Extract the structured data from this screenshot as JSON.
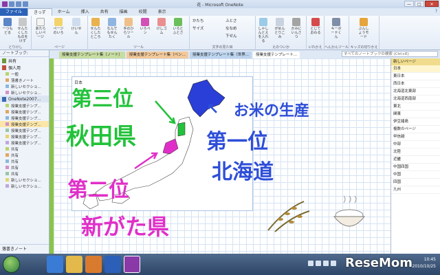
{
  "window": {
    "title": "花 - Microsoft OneNote",
    "buttons": {
      "minimize": "—",
      "maximize": "□",
      "close": "✕"
    }
  },
  "tabs": [
    {
      "label": "ファイル"
    },
    {
      "label": "きっず"
    },
    {
      "label": "ホーム"
    },
    {
      "label": "挿入"
    },
    {
      "label": "共有"
    },
    {
      "label": "描画"
    },
    {
      "label": "校閲"
    },
    {
      "label": "表示"
    }
  ],
  "ribbon": {
    "groups": [
      {
        "label": "とりけし"
      },
      {
        "label": "ページ"
      },
      {
        "label": "ツール"
      },
      {
        "label": "文字の見た目"
      },
      {
        "label": "えのついか"
      },
      {
        "label": "いれかえ"
      },
      {
        "label": "へんかんツール"
      },
      {
        "label": "キッズの切りかえ"
      }
    ],
    "buttons": [
      {
        "label": "一つもどる"
      },
      {
        "label": "せんたくしたものをけす"
      },
      {
        "label": "あたらしいページ"
      },
      {
        "label": "ページのいろ"
      },
      {
        "label": "けいせん"
      },
      {
        "label": "せんたくしたところ"
      },
      {
        "label": "なんでもせんたく"
      },
      {
        "label": "手のひらツール"
      },
      {
        "label": "いろペン"
      },
      {
        "label": "けしゴム"
      },
      {
        "label": "いろとふとさ"
      },
      {
        "label": "かたち"
      },
      {
        "label": "サイズ"
      },
      {
        "label": "ふとさ"
      },
      {
        "label": "ななめ"
      },
      {
        "label": "下せん"
      },
      {
        "label": "しゃしんとえを入れる"
      },
      {
        "label": "がめんとりこみ"
      },
      {
        "label": "かみにいんさつ"
      },
      {
        "label": "とじておわる"
      },
      {
        "label": "キーボードくん"
      },
      {
        "label": "ぶんしょうモード"
      }
    ]
  },
  "nav": {
    "header": "ノートブック:",
    "sections": [
      {
        "label": "共有"
      },
      {
        "label": "個人用"
      }
    ],
    "items_top": [
      "一般",
      "落書きノート",
      "新しいセクショ...",
      "新しいセクショ..."
    ],
    "notebook2": "OneNote2007...",
    "items_bottom": [
      "授業支援テンプ...",
      "授業支援テンプ...",
      "授業支援テンプ...",
      "授業支援テンプ...",
      "授業支援テンプ...",
      "授業支援テンプ...",
      "授業支援テンプ...",
      "共有",
      "共有",
      "共有",
      "共有",
      "共有",
      "新しいセクショ...",
      "新しいセクショ..."
    ],
    "footer": "落書きノート"
  },
  "section_tabs": [
    "授業支援テンプレート集（ノート）",
    "授業支援テンプレート集（ペン...",
    "授業支援テンプレート集（世界...",
    "授業支援テンプレート..."
  ],
  "search": {
    "placeholder": "すべてのノートブックの検索 (Ctrl+E)"
  },
  "page": {
    "map_label": "日本",
    "ink": {
      "third_line1": "第三位",
      "third_line2": "秋田県",
      "second_line1": "第二位",
      "second_line2": "新がた県",
      "top_title": "お米の生産",
      "first_line1": "第一位",
      "first_line2": "北海道",
      "arrow": "↖"
    }
  },
  "pages_pane": {
    "new_page": "新しいページ",
    "items": [
      "日本",
      "東日本",
      "西日本",
      "北海道北東部",
      "北海道西南部",
      "東北",
      "関東",
      "伊豆諸島",
      "複数のページ",
      "甲信越",
      "中部",
      "北陸",
      "近畿",
      "中国四国",
      "中国",
      "四国",
      "九州"
    ]
  },
  "taskbar": {
    "clock_time": "10:45",
    "clock_date": "2010/10/25",
    "watermark": "ReseMom",
    "apps": [
      "ie-icon",
      "folder-icon",
      "media-icon",
      "word-icon",
      "onenote-icon"
    ]
  },
  "colors": {
    "green_ink": "#22c23a",
    "magenta_ink": "#e02fc8",
    "blue_ink": "#2e4ed8",
    "file_tab": "#2a62b8"
  }
}
